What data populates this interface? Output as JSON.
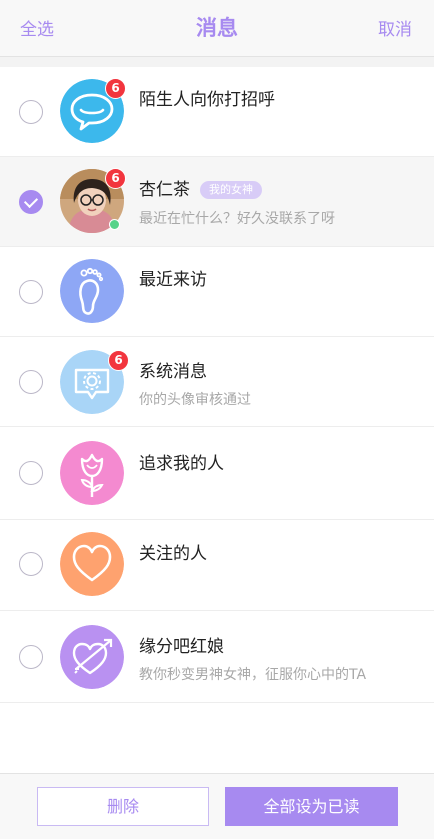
{
  "header": {
    "select_all": "全选",
    "title": "消息",
    "cancel": "取消"
  },
  "items": [
    {
      "name": "陌生人向你打招呼",
      "subtitle": "",
      "badge": "6",
      "selected": false,
      "icon": "chat-bubble-icon",
      "color": "#3cb8ec"
    },
    {
      "name": "杏仁茶",
      "tag": "我的女神",
      "subtitle": "最近在忙什么？好久没联系了呀",
      "badge": "6",
      "selected": true,
      "icon": "user-photo",
      "online": true
    },
    {
      "name": "最近来访",
      "subtitle": "",
      "badge": "",
      "selected": false,
      "icon": "footprint-icon",
      "color": "#8ea7f5"
    },
    {
      "name": "系统消息",
      "subtitle": "你的头像审核通过",
      "badge": "6",
      "selected": false,
      "icon": "system-settings-icon",
      "color": "#a9d5f7"
    },
    {
      "name": "追求我的人",
      "subtitle": "",
      "badge": "",
      "selected": false,
      "icon": "rose-icon",
      "color": "#f48ad0"
    },
    {
      "name": "关注的人",
      "subtitle": "",
      "badge": "",
      "selected": false,
      "icon": "heart-icon",
      "color": "#fea26f"
    },
    {
      "name": "缘分吧红娘",
      "subtitle": "教你秒变男神女神，征服你心中的TA",
      "badge": "",
      "selected": false,
      "icon": "cupid-heart-icon",
      "color": "#b991f1"
    }
  ],
  "footer": {
    "delete_label": "删除",
    "mark_all_read_label": "全部设为已读"
  },
  "colors": {
    "accent": "#a78af0",
    "badge": "#f2353e"
  }
}
